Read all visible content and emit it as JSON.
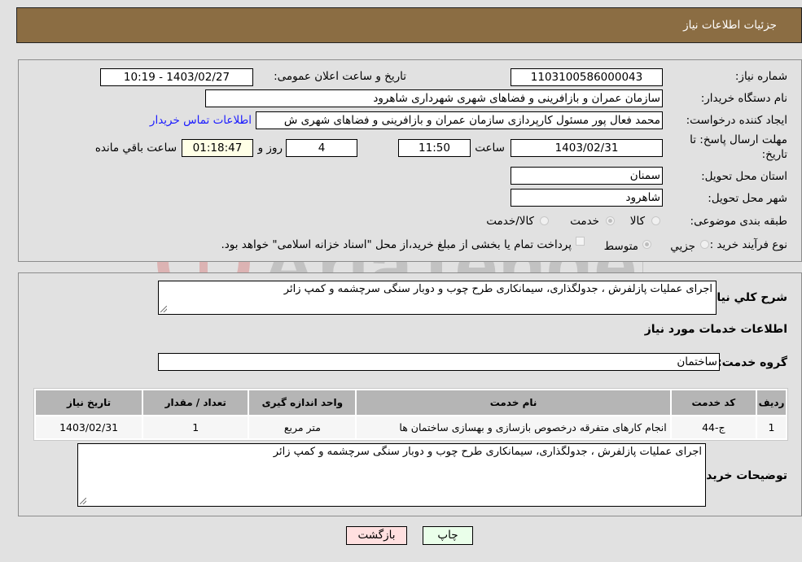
{
  "header": {
    "title": "جزئيات اطلاعات نياز"
  },
  "details": {
    "need_number_label": "شماره نیاز:",
    "need_number": "1103100586000043",
    "announce_label": "تاریخ و ساعت اعلان عمومی:",
    "announce_value": "1403/02/27 - 10:19",
    "buyer_org_label": "نام دستگاه خریدار:",
    "buyer_org": "سازمان عمران و بازافرینی و فضاهای شهری شهرداری شاهرود",
    "creator_label": "ایجاد کننده درخواست:",
    "creator": "محمد فعال پور مسئول کارپردازی سازمان عمران و بازافرینی و فضاهای شهری ش",
    "contact_link": "اطلاعات تماس خریدار",
    "deadline_label_line1": "مهلت ارسال پاسخ: تا",
    "deadline_label_line2": "تاریخ:",
    "deadline_date": "1403/02/31",
    "time_label": "ساعت",
    "deadline_time": "11:50",
    "days_value": "4",
    "days_label": "روز و",
    "remaining_time": "01:18:47",
    "remaining_label": "ساعت باقي مانده",
    "province_label": "استان محل تحویل:",
    "province": "سمنان",
    "city_label": "شهر محل تحویل:",
    "city": "شاهرود",
    "category_label": "طبقه بندی موضوعی:",
    "category_options": [
      {
        "label": "کالا",
        "selected": false
      },
      {
        "label": "خدمت",
        "selected": true
      },
      {
        "label": "کالا/خدمت",
        "selected": false
      }
    ],
    "process_label": "نوع فرآیند خرید :",
    "process_options": [
      {
        "label": "جزیي",
        "selected": false
      },
      {
        "label": "متوسط",
        "selected": true
      }
    ],
    "payment_note": "پرداخت تمام یا بخشی از مبلغ خرید،از محل \"اسناد خزانه اسلامی\" خواهد بود."
  },
  "description": {
    "label": "شرح کلي نياز:",
    "value": "اجرای عملیات پازلفرش ، جدولگذاری، سیمانکاری طرح چوب و دوبار سنگی سرچشمه و کمپ زائر"
  },
  "services": {
    "section_title": "اطلاعات خدمات مورد نياز",
    "group_label": "گروه خدمت:",
    "group_value": "ساختمان",
    "columns": [
      "رديف",
      "کد خدمت",
      "نام خدمت",
      "واحد اندازه گیری",
      "تعداد / مقدار",
      "تاريخ نياز"
    ],
    "rows": [
      {
        "row": "1",
        "code": "ج-44",
        "name": "انجام کارهای متفرقه درخصوص بازسازی و بهسازی ساختمان ها",
        "unit": "متر مربع",
        "qty": "1",
        "date": "1403/02/31"
      }
    ]
  },
  "buyer_notes": {
    "label": "توضیحات خریدار:",
    "value": "اجرای عملیات پازلفرش ، جدولگذاری، سیمانکاری طرح چوب و دوبار سنگی سرچشمه و کمپ زائر"
  },
  "buttons": {
    "print": "چاپ",
    "back": "بازگشت"
  },
  "colors": {
    "header_bg": "#8b6d43",
    "print_bg": "#eaffea",
    "back_bg": "#ffe0e0",
    "link": "#1a1aff"
  },
  "watermark": {
    "text": "AriaTender.neT"
  }
}
